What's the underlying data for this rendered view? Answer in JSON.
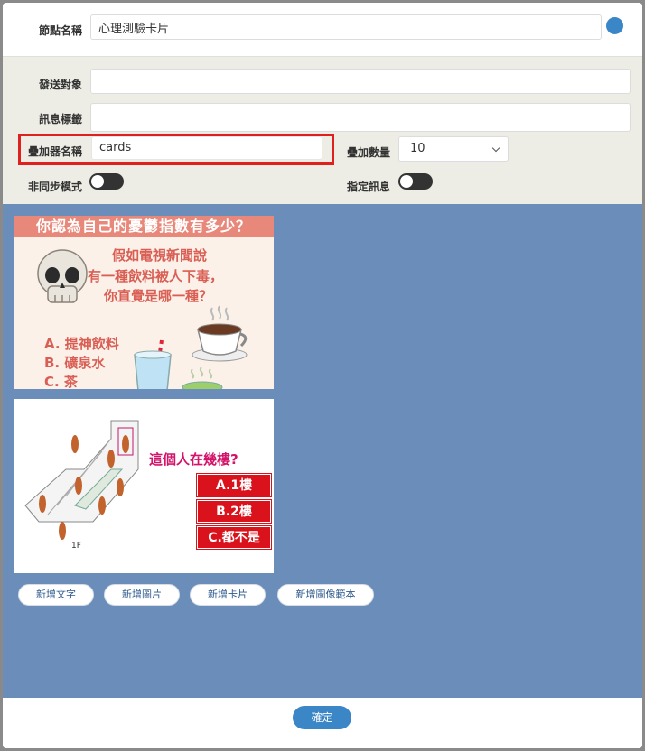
{
  "header": {
    "node_name_label": "節點名稱",
    "node_name_value": "心理測驗卡片"
  },
  "settings": {
    "send_target_label": "發送對象",
    "send_target_value": "",
    "message_tag_label": "訊息標籤",
    "message_tag_value": "",
    "stacker_name_label": "疊加器名稱",
    "stacker_name_value": "cards",
    "stack_count_label": "疊加數量",
    "stack_count_value": "10",
    "async_mode_label": "非同步模式",
    "async_mode_on": false,
    "specified_message_label": "指定訊息",
    "specified_message_on": false
  },
  "cards": [
    {
      "banner": "你認為自己的憂鬱指數有多少？",
      "question_lines": [
        "假如電視新聞說",
        "有一種飲料被人下毒，",
        "你直覺是哪一種？"
      ],
      "options": [
        "A. 提神飲料",
        "B. 礦泉水",
        "C. 茶"
      ],
      "icons": [
        "skull-icon",
        "coffee-cup-icon",
        "water-glass-icon",
        "tea-cup-icon"
      ]
    },
    {
      "question": "這個人在幾樓?",
      "options": [
        "A.1樓",
        "B.2樓",
        "C.都不是"
      ],
      "floor_label": "1F"
    }
  ],
  "actions": {
    "add_text": "新增文字",
    "add_image": "新增圖片",
    "add_card": "新增卡片",
    "add_image_template": "新增圖像範本"
  },
  "footer": {
    "confirm": "確定"
  },
  "colors": {
    "accent": "#3b86c6",
    "content_bg": "#6b8dba",
    "settings_bg": "#edece5",
    "highlight": "#e0201f"
  }
}
